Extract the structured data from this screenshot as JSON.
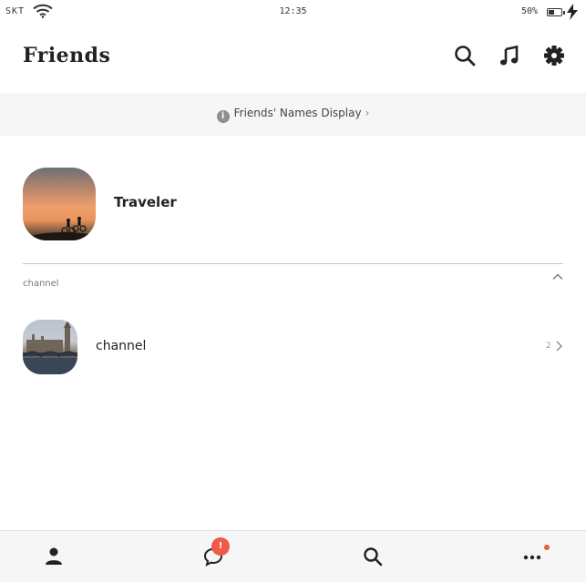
{
  "status_bar": {
    "carrier": "SKT",
    "time": "12:35",
    "battery_percent": "50%",
    "battery_level": 0.5
  },
  "header": {
    "title": "Friends",
    "icons": [
      "search-icon",
      "music-icon",
      "settings-icon"
    ]
  },
  "names_display": {
    "label": "Friends' Names Display"
  },
  "profile": {
    "name": "Traveler"
  },
  "channel_section": {
    "label": "channel",
    "items": [
      {
        "name": "channel",
        "count": "2"
      }
    ]
  },
  "tab_bar": {
    "tabs": [
      "friends",
      "chats",
      "search",
      "more"
    ],
    "chats_badge": "!"
  },
  "colors": {
    "badge": "#f05a48",
    "bar_background": "#f6f6f6",
    "icon": "#222222"
  }
}
